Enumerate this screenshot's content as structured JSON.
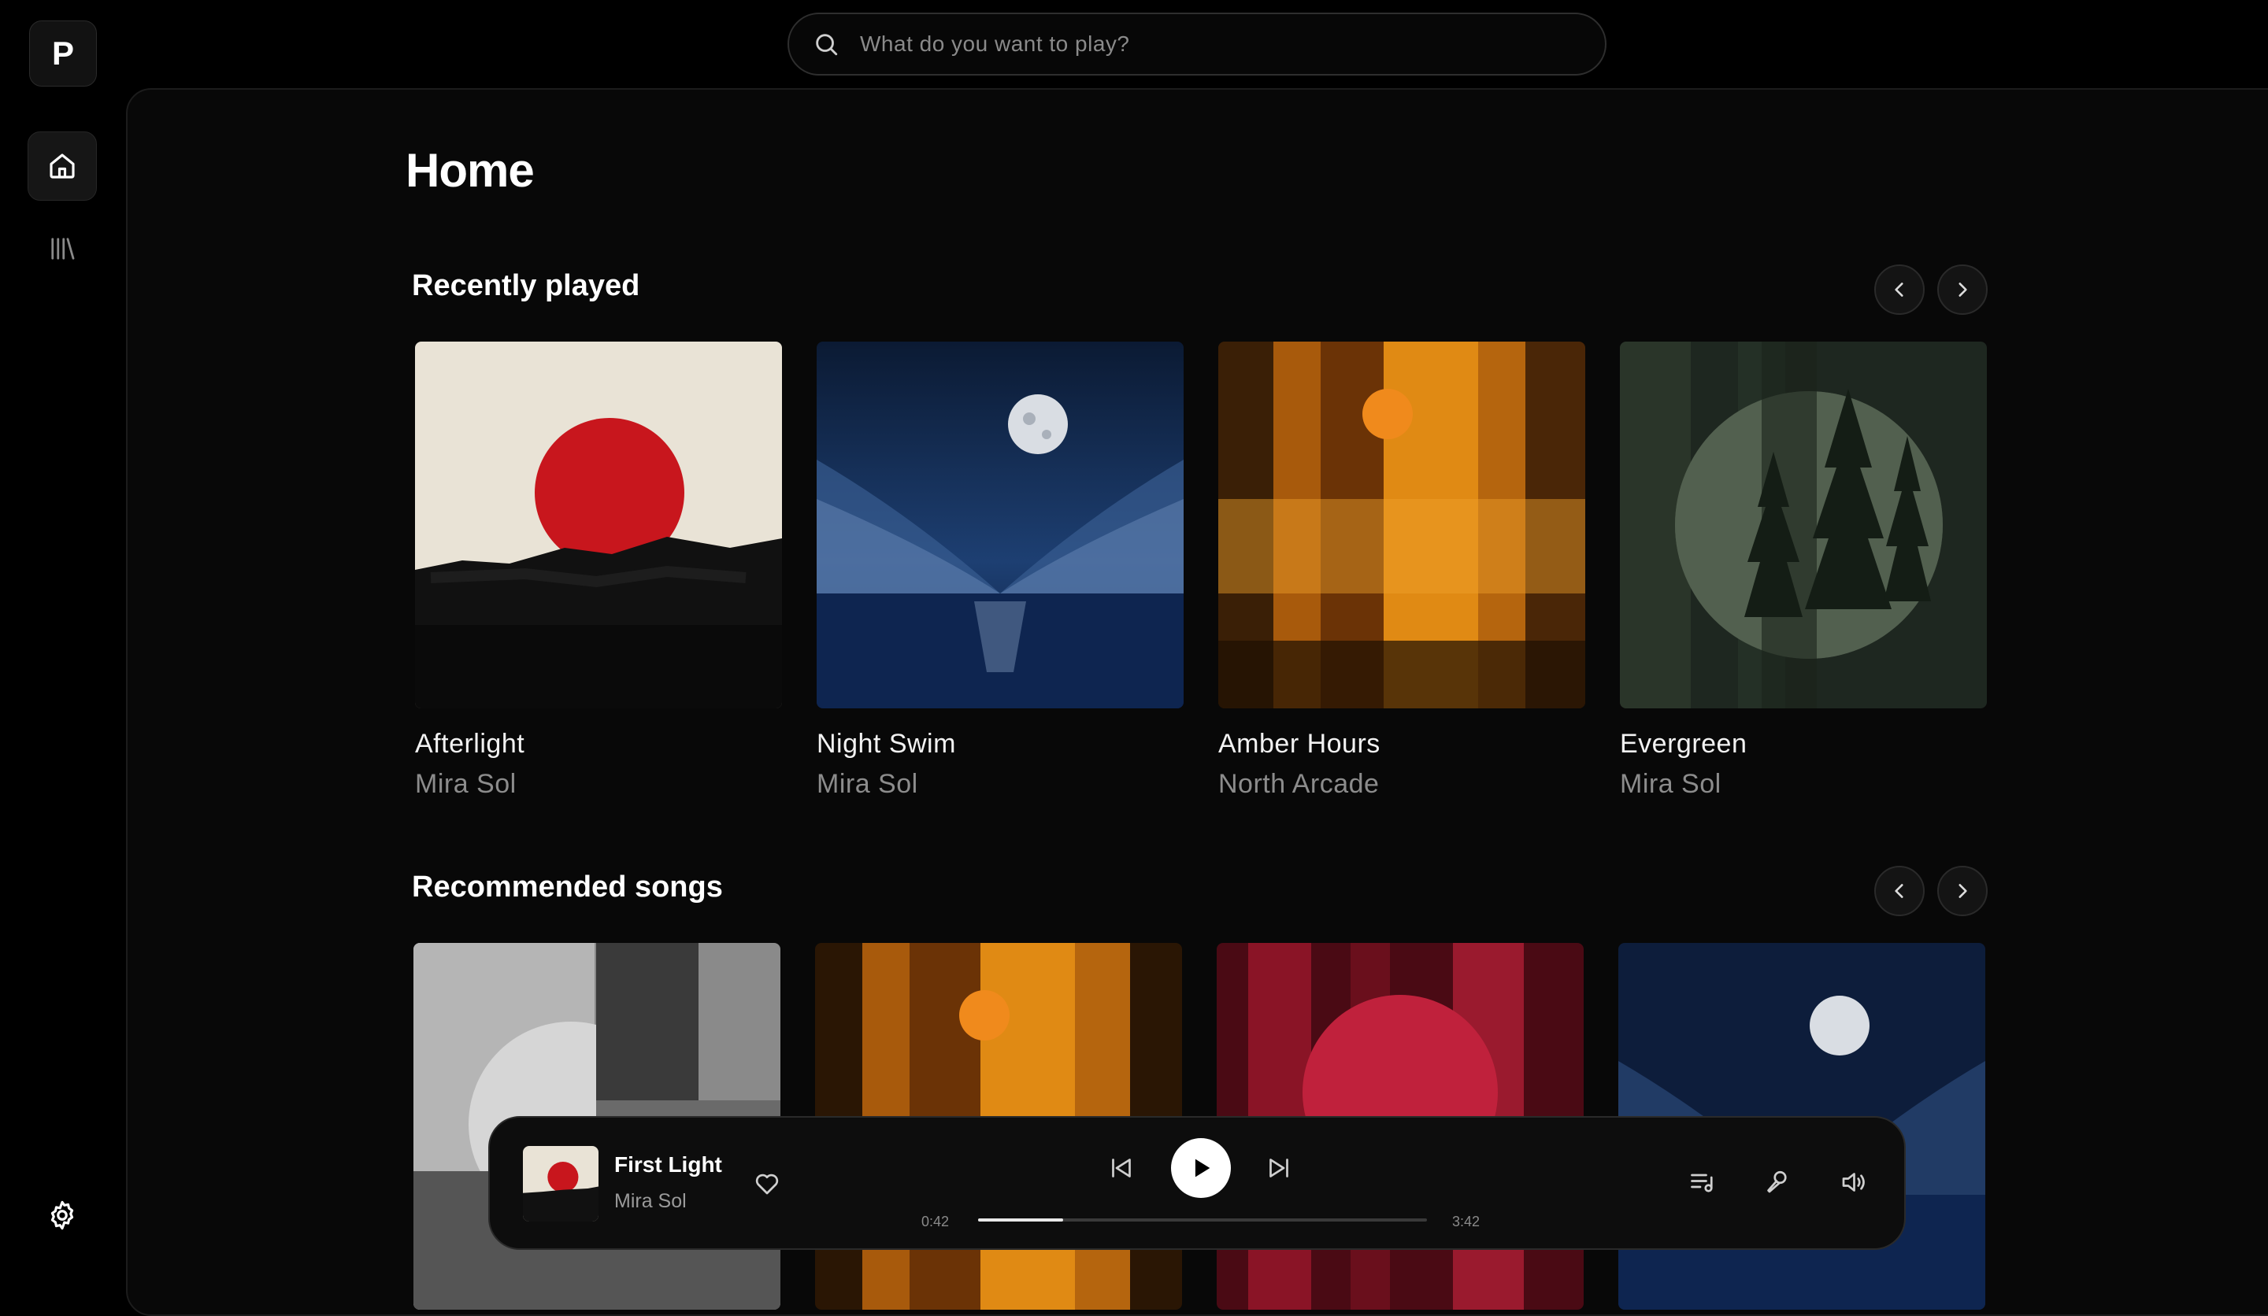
{
  "app": {
    "logo_letter": "P"
  },
  "nav": {
    "home": {
      "icon": "home-icon"
    },
    "library": {
      "icon": "library-icon"
    },
    "settings": {
      "icon": "gear-icon"
    }
  },
  "search": {
    "placeholder": "What do you want to play?",
    "value": ""
  },
  "page": {
    "title": "Home"
  },
  "recently_played": {
    "title": "Recently played",
    "items": [
      {
        "title": "Afterlight",
        "artist": "Mira Sol",
        "art": "red-sun"
      },
      {
        "title": "Night Swim",
        "artist": "Mira Sol",
        "art": "moon-sea"
      },
      {
        "title": "Amber Hours",
        "artist": "North Arcade",
        "art": "amber"
      },
      {
        "title": "Evergreen",
        "artist": "Mira Sol",
        "art": "forest"
      }
    ]
  },
  "recommended": {
    "title": "Recommended songs",
    "items": [
      {
        "art": "mono-geo"
      },
      {
        "art": "amber"
      },
      {
        "art": "crimson"
      },
      {
        "art": "moon-sea"
      }
    ]
  },
  "player": {
    "title": "First Light",
    "artist": "Mira Sol",
    "elapsed": "0:42",
    "duration": "3:42",
    "progress_fraction": 0.19,
    "colors": {
      "accent": "#ffffff",
      "track": "#3a3a3a"
    }
  }
}
